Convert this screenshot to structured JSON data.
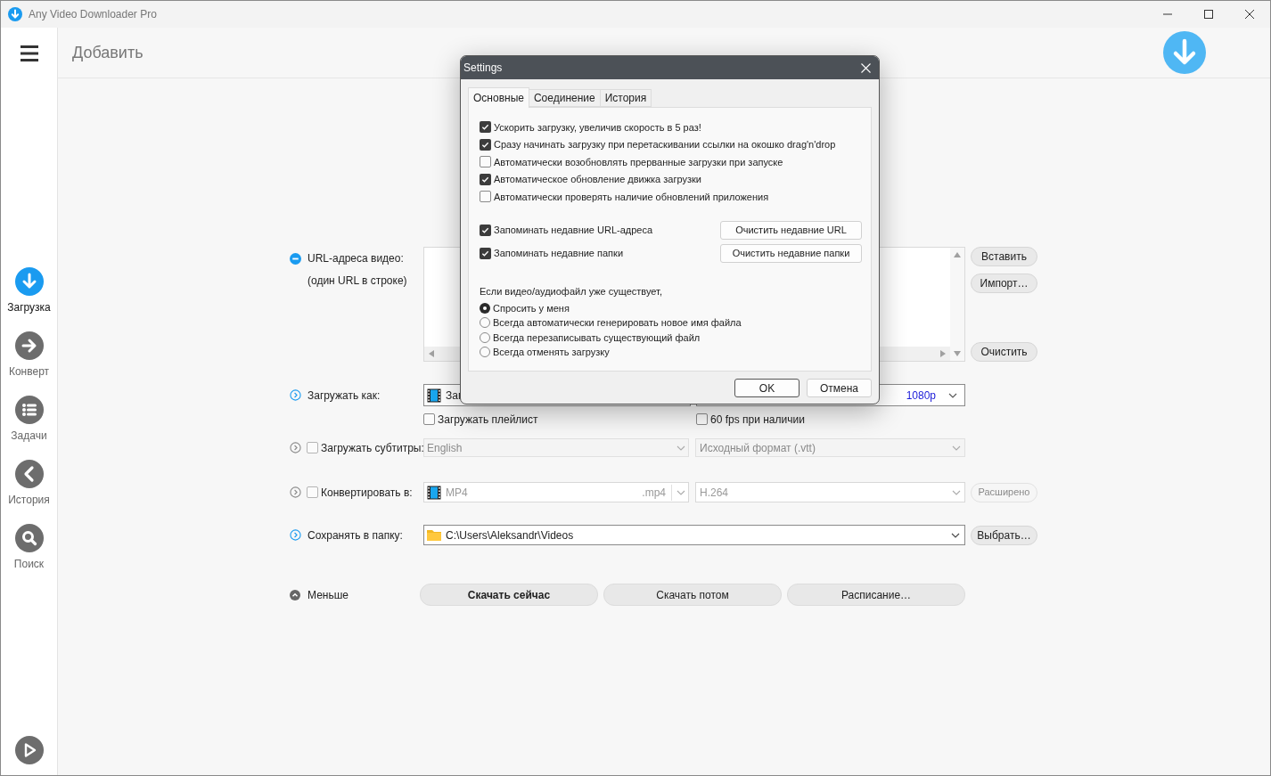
{
  "window": {
    "title": "Any Video Downloader Pro"
  },
  "sidebar": {
    "items": [
      {
        "kind": "download",
        "label": "Загрузка",
        "selected": true
      },
      {
        "kind": "convert",
        "label": "Конверт",
        "selected": false
      },
      {
        "kind": "tasks",
        "label": "Задачи",
        "selected": false
      },
      {
        "kind": "history",
        "label": "История",
        "selected": false
      },
      {
        "kind": "search",
        "label": "Поиск",
        "selected": false
      }
    ]
  },
  "header": {
    "title": "Добавить"
  },
  "form": {
    "urls": {
      "label": "URL-адреса видео:",
      "hint": "(один URL в строке)",
      "paste_button": "Вставить",
      "import_button": "Импорт…",
      "clear_button": "Очистить"
    },
    "download_as": {
      "label": "Загружать как:",
      "format": "Заг",
      "quality": "1080p",
      "playlist": {
        "label": "Загружать плейлист",
        "checked": false
      },
      "fps60": {
        "label": "60 fps при наличии",
        "checked": false
      }
    },
    "subtitles": {
      "label": "Загружать субтитры:",
      "checked": false,
      "disabled": true,
      "language": "English",
      "format": "Исходный формат (.vtt)"
    },
    "convert": {
      "label": "Конвертировать в:",
      "checked": false,
      "disabled": true,
      "format": "MP4",
      "extension": ".mp4",
      "codec": "H.264",
      "advanced_button": "Расширено"
    },
    "folder": {
      "label": "Сохранять в папку:",
      "path": "C:\\Users\\Aleksandr\\Videos",
      "browse_button": "Выбрать…"
    },
    "less": "Меньше",
    "actions": [
      {
        "label": "Скачать сейчас",
        "primary": true
      },
      {
        "label": "Скачать потом",
        "primary": false
      },
      {
        "label": "Расписание…",
        "primary": false
      }
    ]
  },
  "dialog": {
    "title": "Settings",
    "tabs": [
      {
        "label": "Основные",
        "selected": true
      },
      {
        "label": "Соединение",
        "selected": false
      },
      {
        "label": "История",
        "selected": false
      }
    ],
    "options": [
      {
        "label": "Ускорить загрузку, увеличив скорость в 5 раз!",
        "checked": true
      },
      {
        "label": "Сразу начинать загрузку при перетаскивании ссылки на окошко drag'n'drop",
        "checked": true
      },
      {
        "label": "Автоматически возобновлять прерванные загрузки при запуске",
        "checked": false
      },
      {
        "label": "Автоматическое обновление движка загрузки",
        "checked": true
      },
      {
        "label": "Автоматически проверять наличие обновлений приложения",
        "checked": false
      }
    ],
    "remember": [
      {
        "label": "Запоминать недавние URL-адреса",
        "checked": true,
        "button": "Очистить недавние URL"
      },
      {
        "label": "Запоминать недавние папки",
        "checked": true,
        "button": "Очистить недавние папки"
      }
    ],
    "exists_label": "Если видео/аудиофайл уже существует,",
    "radios": [
      {
        "label": "Спросить у меня",
        "selected": true
      },
      {
        "label": "Всегда автоматически генерировать новое имя файла",
        "selected": false
      },
      {
        "label": "Всегда перезаписывать существующий файл",
        "selected": false
      },
      {
        "label": "Всегда отменять загрузку",
        "selected": false
      }
    ],
    "buttons": [
      {
        "label": "OK",
        "default": true
      },
      {
        "label": "Отмена",
        "default": false
      }
    ]
  }
}
